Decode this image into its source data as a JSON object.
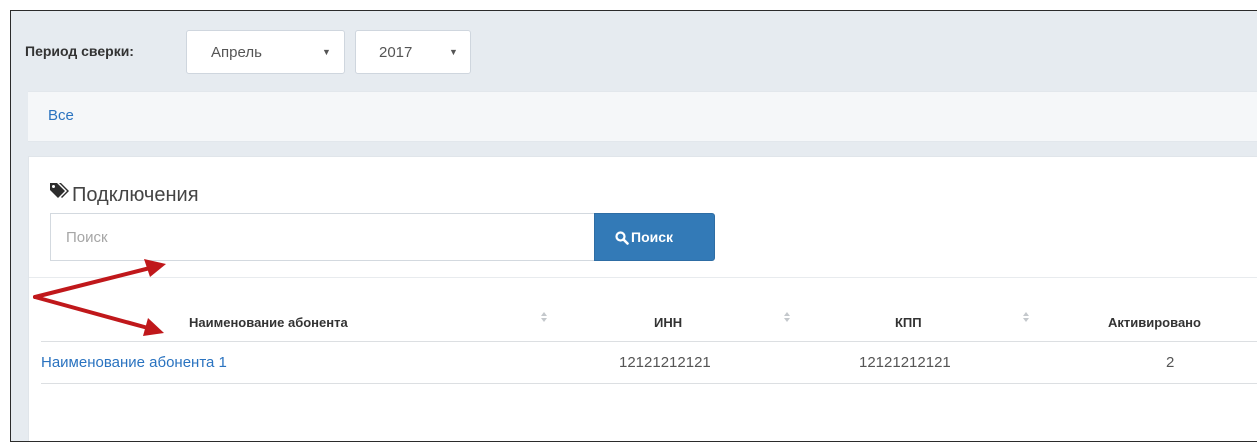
{
  "period": {
    "label": "Период сверки:",
    "month": "Апрель",
    "year": "2017"
  },
  "filter": {
    "all_label": "Все"
  },
  "section": {
    "title": "Подключения",
    "icon": "tags-icon"
  },
  "search": {
    "placeholder": "Поиск",
    "value": "",
    "button_label": "Поиск",
    "button_icon": "search-icon"
  },
  "table": {
    "columns": [
      "Наименование абонента",
      "ИНН",
      "КПП",
      "Активировано"
    ],
    "rows": [
      [
        "Наименование абонента 1",
        "12121212121",
        "12121212121",
        "2"
      ]
    ]
  },
  "colors": {
    "accent": "#337ab7",
    "link": "#2a73c0",
    "annotation": "#c0181b"
  }
}
